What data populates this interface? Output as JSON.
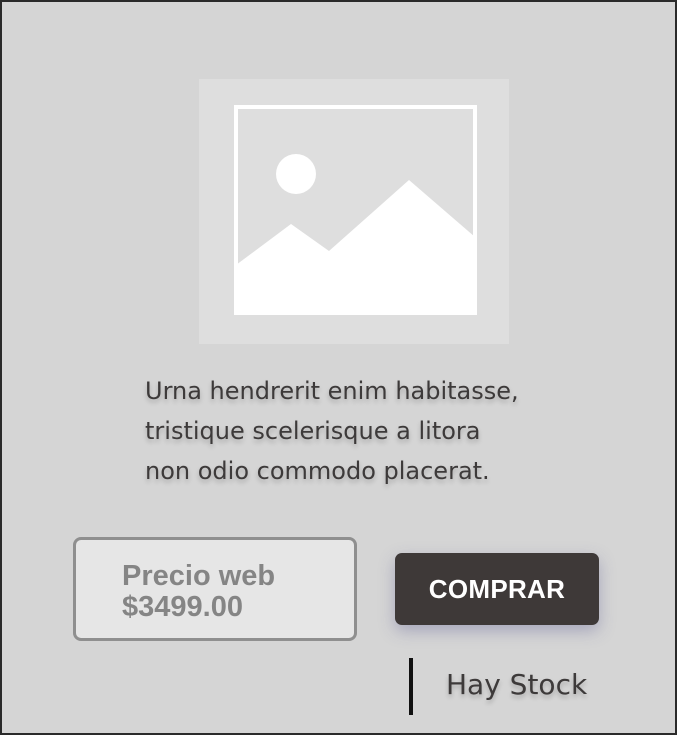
{
  "product": {
    "image_icon": "image-placeholder-icon",
    "description_lines": [
      "Urna hendrerit enim habitasse,",
      "tristique scelerisque a litora",
      "non odio commodo placerat."
    ],
    "price_label": "Precio web",
    "price_value": "$3499.00",
    "buy_label": "COMPRAR",
    "stock_label": "Hay Stock"
  },
  "colors": {
    "card_background": "#d5d5d5",
    "button_background": "#3e3938",
    "price_box_background": "#e6e6e6",
    "text": "#3d3a3a"
  }
}
